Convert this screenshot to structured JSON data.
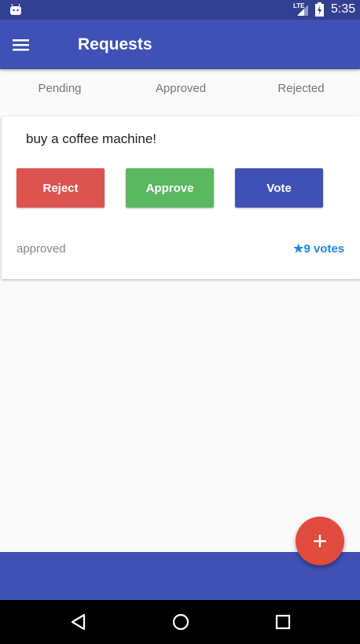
{
  "status_bar": {
    "time": "5:35",
    "network": "LTE"
  },
  "app_bar": {
    "title": "Requests"
  },
  "tabs": [
    {
      "label": "Pending"
    },
    {
      "label": "Approved"
    },
    {
      "label": "Rejected"
    }
  ],
  "request_card": {
    "title": "buy a coffee machine!",
    "reject_label": "Reject",
    "approve_label": "Approve",
    "vote_label": "Vote",
    "status": "approved",
    "votes": "9 votes"
  },
  "fab": {
    "label": "+"
  },
  "colors": {
    "primary": "#3F51B5",
    "reject": "#DB5450",
    "approve": "#5CB860",
    "fab": "#E04B3E",
    "link": "#1E88E5"
  }
}
